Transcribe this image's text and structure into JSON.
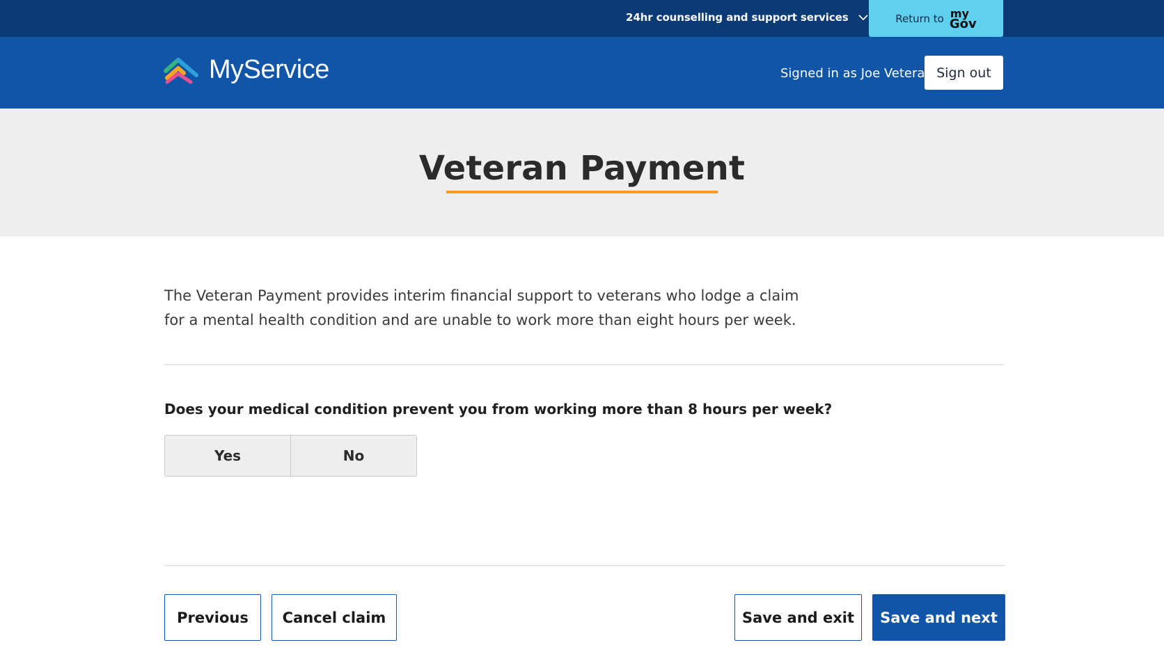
{
  "utility_bar": {
    "support_label": "24hr counselling and support services",
    "mygov_return_label": "Return to",
    "mygov_logo_my": "my",
    "mygov_logo_gov": "Gov",
    "background": "#0b3b75",
    "mygov_color": "#5fd1ef"
  },
  "header": {
    "brand_name": "MyService",
    "signed_in_text": "Signed in as Joe Veteran",
    "sign_out_label": "Sign out",
    "background": "#1155a8"
  },
  "page": {
    "title": "Veteran Payment",
    "accent": "#f39a1f",
    "intro": "The Veteran Payment provides interim financial support to veterans who lodge a claim for a mental health condition and are unable to work more than eight hours per week."
  },
  "question": {
    "text": "Does your medical condition prevent you from working more than 8 hours per week?",
    "options": [
      "Yes",
      "No"
    ]
  },
  "footer": {
    "previous_label": "Previous",
    "cancel_label": "Cancel claim",
    "save_exit_label": "Save and exit",
    "save_next_label": "Save and next"
  },
  "icons": {
    "support_chevron": "chevron-down-icon",
    "brand_logo": "myservice-logo-icon"
  }
}
